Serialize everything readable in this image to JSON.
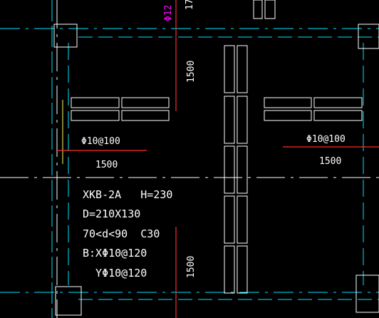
{
  "drawing": {
    "colors": {
      "background": "#000000",
      "outline": "#ffffff",
      "axis": "#00e5ff",
      "center_line": "#ffffff",
      "rebar": "#ff2a2a",
      "edge": "#ffff66",
      "dimension_top": "#ff00ff"
    },
    "labels": {
      "top_partial": "17",
      "top_partial_magenta": "Φ12",
      "dim_top_vertical": "1500",
      "dim_bottom_vertical": "1500",
      "left_rebar": "Φ10@100",
      "left_span": "1500",
      "right_rebar": "Φ10@100",
      "right_span": "1500"
    },
    "slab_note": {
      "line1": "XKB-2A   H=230",
      "line2": "D=210X130",
      "line3": "70<d<90  C30",
      "line4": "B:XΦ10@120",
      "line5": "  YΦ10@120"
    }
  }
}
